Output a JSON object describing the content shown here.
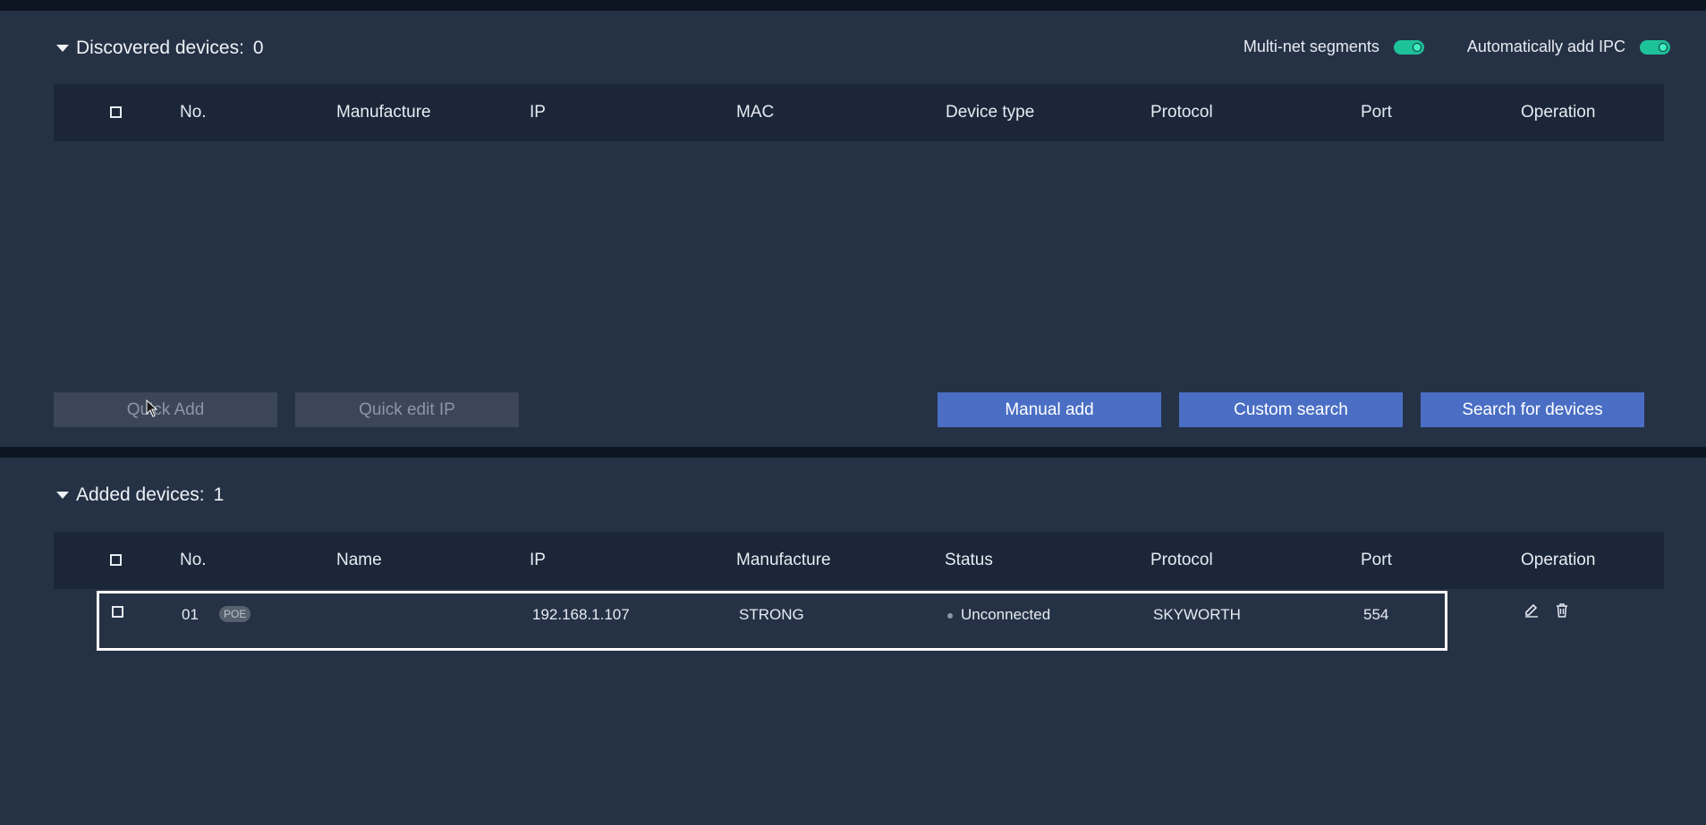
{
  "discovered": {
    "title": "Discovered  devices:",
    "count": "0",
    "multi_net_label": "Multi-net  segments",
    "multi_net_on": true,
    "auto_add_label": "Automatically  add  IPC",
    "auto_add_on": true,
    "columns": [
      "No.",
      "Manufacture",
      "IP",
      "MAC",
      "Device  type",
      "Protocol",
      "Port",
      "Operation"
    ],
    "buttons": {
      "quick_add": "Quick  Add",
      "quick_edit_ip": "Quick  edit  IP",
      "manual_add": "Manual  add",
      "custom_search": "Custom  search",
      "search_devices": "Search  for  devices"
    }
  },
  "added": {
    "title": "Added  devices:",
    "count": "1",
    "columns": [
      "No.",
      "Name",
      "IP",
      "Manufacture",
      "Status",
      "Protocol",
      "Port",
      "Operation"
    ],
    "rows": [
      {
        "no": "01",
        "badge": "POE",
        "name": "",
        "ip": "192.168.1.107",
        "manufacture": "STRONG",
        "status": "Unconnected",
        "protocol": "SKYWORTH",
        "port": "554"
      }
    ]
  },
  "colors": {
    "panel": "#253246",
    "header_row": "#1b2638",
    "accent_toggle": "#1ec39a",
    "primary_button": "#4a6ec4",
    "disabled_button": "#3b4759"
  },
  "icons": [
    "caret-down-icon",
    "edit-icon",
    "delete-icon",
    "mouse-cursor-icon"
  ]
}
